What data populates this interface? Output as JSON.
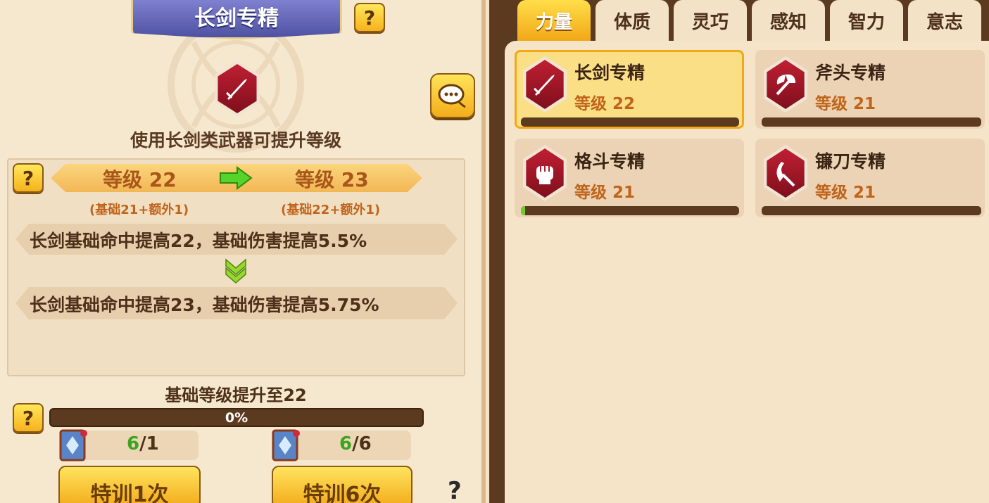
{
  "detail": {
    "title": "长剑专精",
    "description": "使用长剑类武器可提升等级",
    "current_level": "等级 22",
    "next_level": "等级 23",
    "current_breakdown": "(基础21+额外1)",
    "next_breakdown": "(基础22+额外1)",
    "current_effect": "长剑基础命中提高22，基础伤害提高5.5%",
    "next_effect": "长剑基础命中提高23，基础伤害提高5.75%",
    "base_upgrade": "基础等级提升至22",
    "progress_text": "0%",
    "progress": 0,
    "cost1": {
      "have": "6",
      "need": "/1"
    },
    "cost6": {
      "have": "6",
      "need": "/6"
    },
    "train1_label": "特训1次",
    "train6_label": "特训6次",
    "help_mark": "?"
  },
  "tabs": [
    {
      "label": "力量",
      "active": true
    },
    {
      "label": "体质",
      "active": false
    },
    {
      "label": "灵巧",
      "active": false
    },
    {
      "label": "感知",
      "active": false
    },
    {
      "label": "智力",
      "active": false
    },
    {
      "label": "意志",
      "active": false
    }
  ],
  "skills": [
    {
      "name": "长剑专精",
      "level": "等级 22",
      "icon": "sword-icon",
      "progress": 0,
      "selected": true
    },
    {
      "name": "斧头专精",
      "level": "等级 21",
      "icon": "axe-icon",
      "progress": 0,
      "selected": false
    },
    {
      "name": "格斗专精",
      "level": "等级 21",
      "icon": "fist-icon",
      "progress": 0.02,
      "selected": false
    },
    {
      "name": "镰刀专精",
      "level": "等级 21",
      "icon": "scythe-icon",
      "progress": 0,
      "selected": false
    }
  ],
  "colors": {
    "accent": "#f6b21c",
    "level_text": "#c0641a",
    "progress_green": "#6fd02a",
    "bar_dark": "#5b3a1f",
    "skill_red": "#a8182b"
  }
}
